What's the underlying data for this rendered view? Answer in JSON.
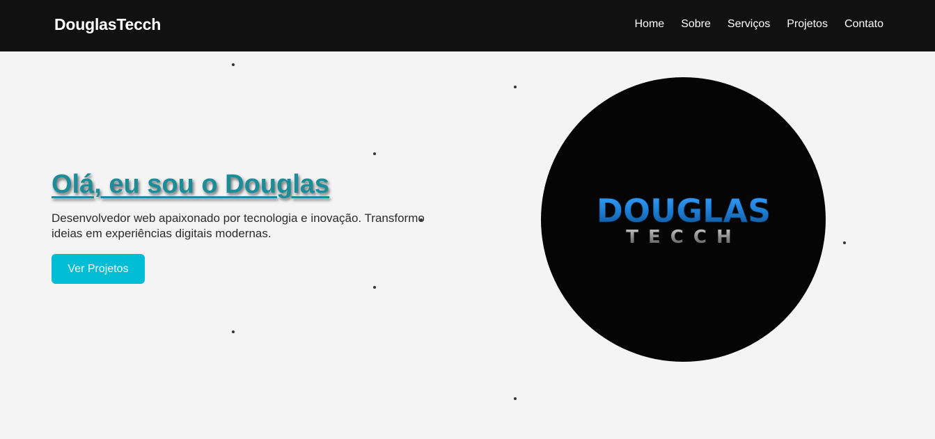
{
  "header": {
    "brand": "DouglasTecch",
    "nav": [
      {
        "label": "Home"
      },
      {
        "label": "Sobre"
      },
      {
        "label": "Serviços"
      },
      {
        "label": "Projetos"
      },
      {
        "label": "Contato"
      }
    ]
  },
  "hero": {
    "title": "Olá, eu sou o Douglas",
    "description": "Desenvolvedor web apaixonado por tecnologia e inovação. Transformo ideias em experiências digitais modernas.",
    "cta_label": "Ver Projetos"
  },
  "logo": {
    "line1": "DOUGLAS",
    "line2": "TECCH"
  },
  "colors": {
    "nav_background": "#111111",
    "page_background": "#f4f4f4",
    "title": "#1a8d99",
    "accent_button": "#00bcd4",
    "logo_background": "#050505",
    "logo_blue": "#1e7fd4",
    "logo_silver": "#8a8a8a"
  }
}
